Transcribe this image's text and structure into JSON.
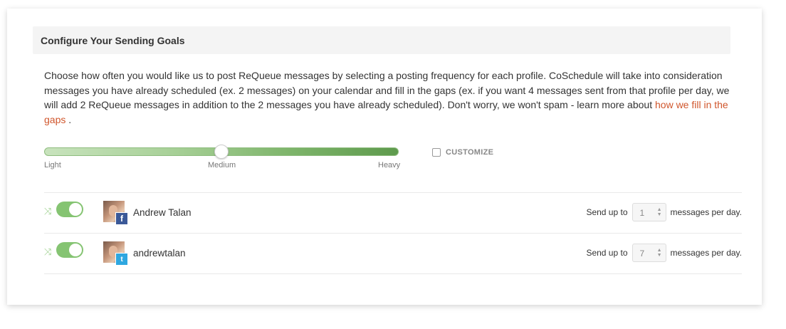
{
  "section": {
    "title": "Configure Your Sending Goals",
    "description": "Choose how often you would like us to post ReQueue messages by selecting a posting frequency for each profile. CoSchedule will take into consideration messages you have already scheduled (ex. 2 messages) on your calendar and fill in the gaps (ex. if you want 4 messages sent from that profile per day, we will add 2 ReQueue messages in addition to the 2 messages you have already scheduled). Don't worry, we won't spam - learn more about ",
    "link_text": "how we fill in the gaps",
    "description_end": " ."
  },
  "slider": {
    "labels": [
      "Light",
      "Medium",
      "Heavy"
    ],
    "selected": "Medium",
    "level": 0.5
  },
  "customize": {
    "label": "CUSTOMIZE",
    "checked": false
  },
  "profiles": [
    {
      "name": "Andrew Talan",
      "network": "facebook",
      "badge": "f",
      "enabled": true,
      "send_prefix": "Send up to",
      "count": "1",
      "send_suffix": "messages per day."
    },
    {
      "name": "andrewtalan",
      "network": "twitter",
      "badge": "t",
      "enabled": true,
      "send_prefix": "Send up to",
      "count": "7",
      "send_suffix": "messages per day."
    }
  ],
  "colors": {
    "accent_green": "#85c472",
    "link": "#d0562c",
    "facebook": "#3b5998",
    "twitter": "#2ea7e0"
  }
}
